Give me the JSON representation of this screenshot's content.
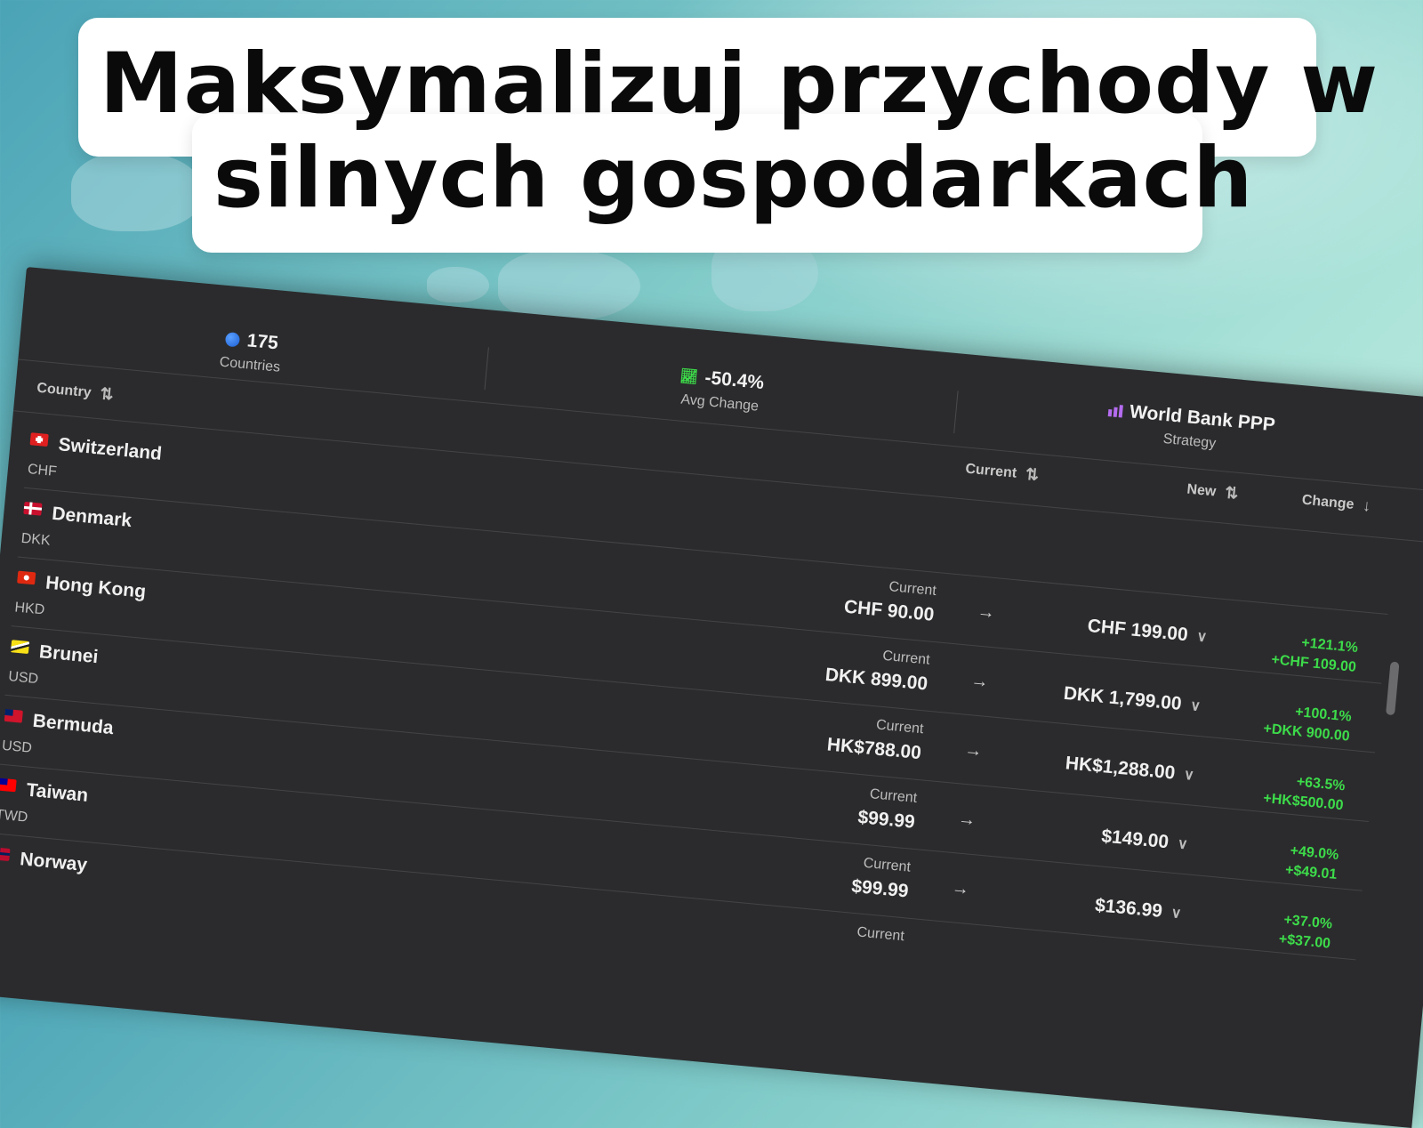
{
  "headline": {
    "line1": "Maksymalizuj przychody w",
    "line2": "silnych gospodarkach"
  },
  "stats": {
    "countries": {
      "value": "175",
      "label": "Countries",
      "icon": "globe-icon"
    },
    "avg_change": {
      "value": "-50.4%",
      "label": "Avg Change",
      "icon": "trend-chart-icon"
    },
    "strategy": {
      "value": "World Bank PPP",
      "label": "Strategy",
      "icon": "bar-chart-icon"
    }
  },
  "columns": {
    "country": "Country",
    "current": "Current",
    "new": "New",
    "change": "Change"
  },
  "first_row": {
    "name": "Switzerland",
    "code": "CHF"
  },
  "rows": [
    {
      "name": "Denmark",
      "code": "DKK",
      "current_label": "Current",
      "current": "CHF 90.00",
      "new": "CHF 199.00",
      "pct": "+121.1%",
      "abs": "+CHF 109.00"
    },
    {
      "name": "Hong Kong",
      "code": "HKD",
      "current_label": "Current",
      "current": "DKK 899.00",
      "new": "DKK 1,799.00",
      "pct": "+100.1%",
      "abs": "+DKK 900.00"
    },
    {
      "name": "Brunei",
      "code": "USD",
      "current_label": "Current",
      "current": "HK$788.00",
      "new": "HK$1,288.00",
      "pct": "+63.5%",
      "abs": "+HK$500.00"
    },
    {
      "name": "Bermuda",
      "code": "USD",
      "current_label": "Current",
      "current": "$99.99",
      "new": "$149.00",
      "pct": "+49.0%",
      "abs": "+$49.01"
    },
    {
      "name": "Taiwan",
      "code": "TWD",
      "current_label": "Current",
      "current": "$99.99",
      "new": "$136.99",
      "pct": "+37.0%",
      "abs": "+$37.00"
    },
    {
      "name": "Norway",
      "code": "",
      "current_label": "Current",
      "current": "",
      "new": "",
      "pct": "",
      "abs": ""
    }
  ],
  "colors": {
    "positive": "#3ddc4a",
    "panel": "#2b2b2d"
  }
}
